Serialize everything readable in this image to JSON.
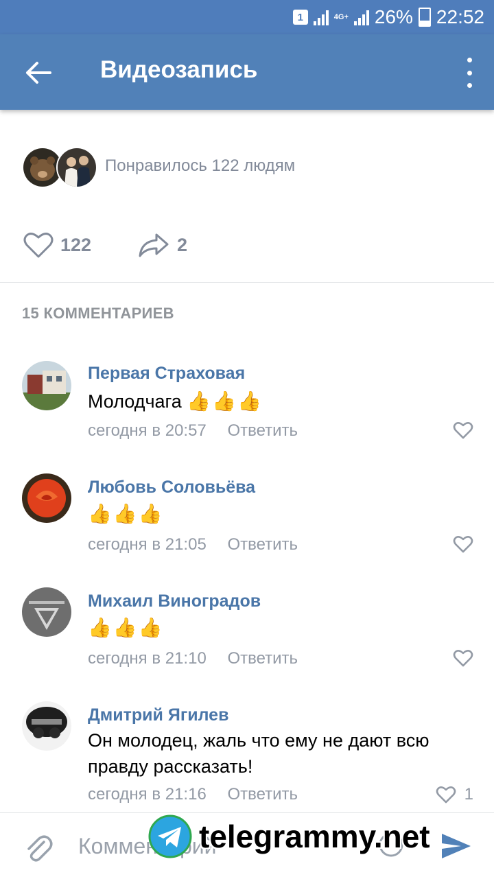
{
  "status_bar": {
    "sim": "1",
    "network": "4G+",
    "battery": "26%",
    "time": "22:52"
  },
  "app_bar": {
    "title": "Видеозапись",
    "back_icon": "arrow-left-icon",
    "menu_icon": "more-vertical-icon"
  },
  "likes_summary": {
    "text": "Понравилось 122 людям"
  },
  "actions": {
    "likes_count": "122",
    "shares_count": "2"
  },
  "comments": {
    "header": "15 КОММЕНТАРИЕВ",
    "items": [
      {
        "author": "Первая Страховая",
        "text": "Молодчага",
        "emoji": "👍👍👍",
        "time": "сегодня в 20:57",
        "reply": "Ответить",
        "likes": ""
      },
      {
        "author": "Любовь Соловьёва",
        "text": "",
        "emoji": "👍👍👍",
        "time": "сегодня в 21:05",
        "reply": "Ответить",
        "likes": ""
      },
      {
        "author": "Михаил Виноградов",
        "text": "",
        "emoji": "👍👍👍",
        "time": "сегодня в 21:10",
        "reply": "Ответить",
        "likes": ""
      },
      {
        "author": "Дмитрий Ягилев",
        "text": "Он молодец, жаль что ему не дают всю правду рассказать!",
        "emoji": "",
        "time": "сегодня в 21:16",
        "reply": "Ответить",
        "likes": "1"
      }
    ]
  },
  "composer": {
    "placeholder": "Комментарий"
  },
  "watermark": {
    "text": "telegrammy.net"
  },
  "colors": {
    "header": "#5181b8",
    "status_bar": "#4f7dbb",
    "link": "#4a76a8",
    "secondary": "#828a99"
  }
}
